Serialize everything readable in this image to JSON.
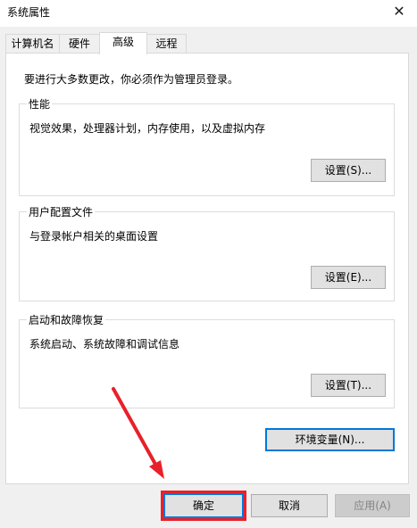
{
  "window": {
    "title": "系统属性",
    "close_glyph": "✕"
  },
  "tabs": [
    {
      "label": "计算机名"
    },
    {
      "label": "硬件"
    },
    {
      "label": "高级"
    },
    {
      "label": "远程"
    }
  ],
  "active_tab": "高级",
  "notice": "要进行大多数更改，你必须作为管理员登录。",
  "groups": {
    "performance": {
      "title": "性能",
      "description": "视觉效果，处理器计划，内存使用，以及虚拟内存",
      "button": "设置(S)..."
    },
    "user_profiles": {
      "title": "用户配置文件",
      "description": "与登录帐户相关的桌面设置",
      "button": "设置(E)..."
    },
    "startup_recovery": {
      "title": "启动和故障恢复",
      "description": "系统启动、系统故障和调试信息",
      "button": "设置(T)..."
    }
  },
  "env_button": "环境变量(N)...",
  "footer": {
    "ok": "确定",
    "cancel": "取消",
    "apply": "应用(A)"
  },
  "colors": {
    "annotation": "#e8202a",
    "focus_border": "#0078d7"
  }
}
